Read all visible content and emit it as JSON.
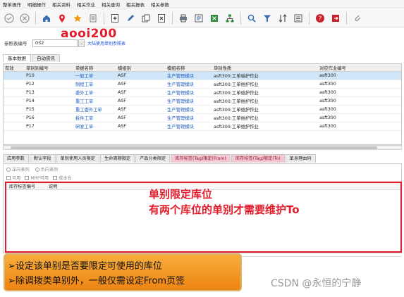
{
  "menu": [
    "整单操作",
    "明细操作",
    "相关资料",
    "相关作业",
    "相关查询",
    "相关报表",
    "相关参数"
  ],
  "toolbar": {
    "icons": [
      "confirm-icon",
      "cancel-icon",
      "home-icon",
      "location-icon",
      "favorite-icon",
      "list-icon",
      "new-icon",
      "edit-icon",
      "copy-icon",
      "delete-icon",
      "print-icon",
      "preview-icon",
      "export-icon",
      "network-icon",
      "search-icon",
      "filter-icon",
      "sort-icon",
      "form-icon",
      "help-icon",
      "exit-icon",
      "attach-icon"
    ]
  },
  "query": {
    "label": "参照表编号",
    "value": "032",
    "button": "...",
    "link": "大陆使用单别参照表"
  },
  "annotation_user": "aooi200",
  "top_tabs": [
    "基本数据",
    "自动资讯"
  ],
  "grid": {
    "headers": [
      "有效",
      "单别别编号",
      "单据名称",
      "模组别",
      "模组名称",
      "单别性质",
      "对应作业编号"
    ],
    "rows": [
      {
        "code": "P10",
        "name": "一般工单",
        "module": "ASF",
        "module_name": "生产管理模块",
        "nature": "asft300:工单维护作业",
        "job": "asft300"
      },
      {
        "code": "P12",
        "name": "制程工单",
        "module": "ASF",
        "module_name": "生产管理模块",
        "nature": "asft300:工单维护作业",
        "job": "asft300"
      },
      {
        "code": "P13",
        "name": "委外工单",
        "module": "ASF",
        "module_name": "生产管理模块",
        "nature": "asft300:工单维护作业",
        "job": "asft300"
      },
      {
        "code": "P14",
        "name": "重工工单",
        "module": "ASF",
        "module_name": "生产管理模块",
        "nature": "asft300:工单维护作业",
        "job": "asft300"
      },
      {
        "code": "P15",
        "name": "重工委外工单",
        "module": "ASF",
        "module_name": "生产管理模块",
        "nature": "asft300:工单维护作业",
        "job": "asft300"
      },
      {
        "code": "P16",
        "name": "拆件工单",
        "module": "ASF",
        "module_name": "生产管理模块",
        "nature": "asft300:工单维护作业",
        "job": "asft300"
      },
      {
        "code": "P17",
        "name": "研发工单",
        "module": "ASF",
        "module_name": "生产管理模块",
        "nature": "asft300:工单维护作业",
        "job": "asft300"
      }
    ]
  },
  "bottom_tabs": [
    "应用参数",
    "默认字段",
    "单别使用人员限定",
    "生命周期限定",
    "产品分类限定",
    "库存标签(Tag)限定(From)",
    "库存标签(Tag)限定(To)",
    "单身理由码"
  ],
  "detail": {
    "radios": [
      "正向表列",
      "负向表列"
    ],
    "checks": [
      "可用",
      "MRP可用",
      "成本仓"
    ],
    "columns": [
      "库存标签编号",
      "说明"
    ],
    "note_line1": "单别限定库位",
    "note_line2": "有两个库位的单别才需要维护To"
  },
  "banner": {
    "line1": "➢设定该单别是否要限定可使用的库位",
    "line2": "➢除调拨类单别外，一般仅需设定From页签"
  },
  "watermark": "CSDN @永恒的宁静"
}
